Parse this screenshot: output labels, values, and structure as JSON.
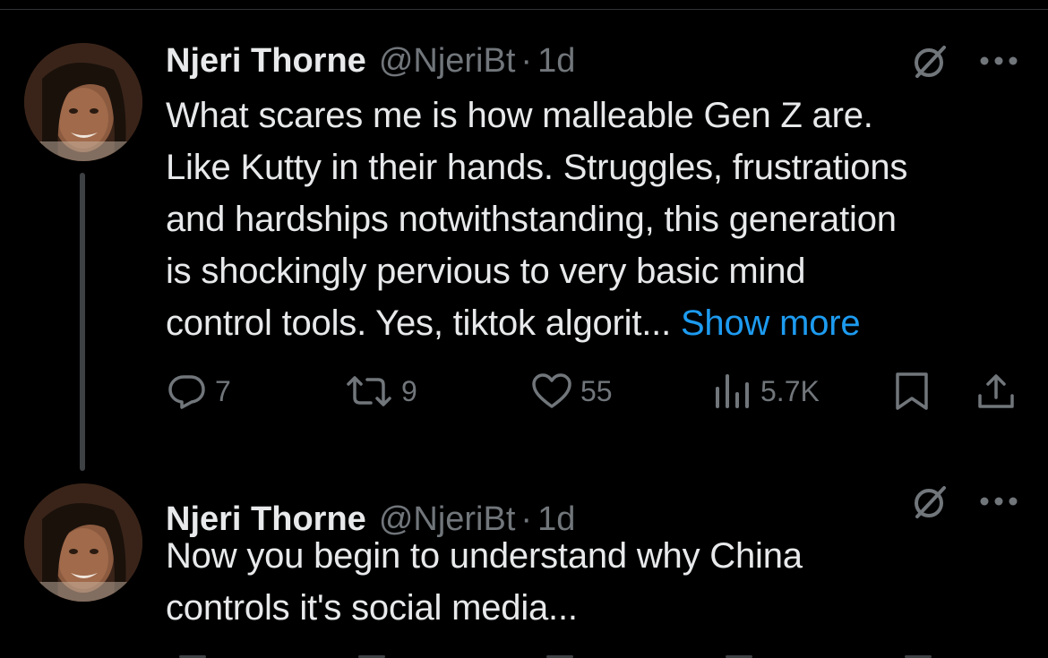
{
  "tweets": [
    {
      "author_name": "Njeri Thorne",
      "handle": "@NjeriBt",
      "separator": "·",
      "time": "1d",
      "body_lines": [
        "What scares me is how malleable Gen Z are.",
        "Like Kutty in their hands. Struggles, frustrations",
        "and hardships notwithstanding, this generation",
        "is shockingly pervious to very basic mind",
        "control tools. Yes, tiktok algorit..."
      ],
      "show_more": "Show more",
      "stats": {
        "replies": "7",
        "reposts": "9",
        "likes": "55",
        "views": "5.7K"
      }
    },
    {
      "author_name": "Njeri Thorne",
      "handle": "@NjeriBt",
      "separator": "·",
      "time": "1d",
      "body_lines": [
        "Now you begin to understand why China",
        "controls it's social media..."
      ]
    }
  ],
  "icons": {
    "not_interested": "no-sign-icon",
    "more": "more-icon",
    "reply": "reply-icon",
    "repost": "repost-icon",
    "like": "heart-icon",
    "views": "views-icon",
    "bookmark": "bookmark-icon",
    "share": "share-icon"
  },
  "colors": {
    "background": "#000000",
    "text": "#e7e9ea",
    "muted": "#71767b",
    "link": "#1d9bf0",
    "thread_line": "#3e4144"
  }
}
